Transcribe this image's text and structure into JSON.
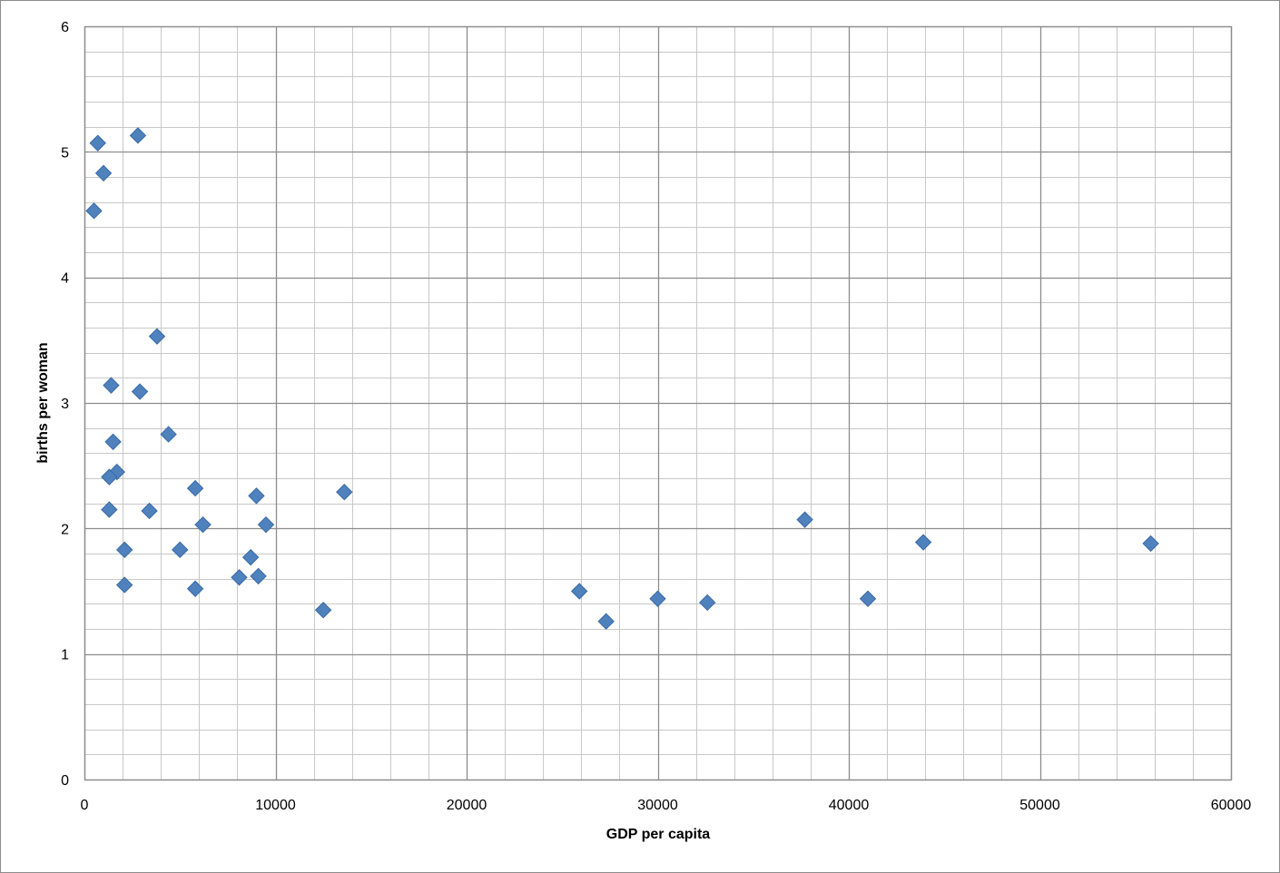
{
  "chart_data": {
    "type": "scatter",
    "title": "",
    "xlabel": "GDP per capita",
    "ylabel": "births per woman",
    "xlim": [
      0,
      60000
    ],
    "ylim": [
      0,
      6
    ],
    "x_major": 10000,
    "x_minor": 2000,
    "y_major": 1,
    "y_minor": 0.2,
    "x_tick_labels": [
      "0",
      "10000",
      "20000",
      "30000",
      "40000",
      "50000",
      "60000"
    ],
    "y_tick_labels": [
      "0",
      "1",
      "2",
      "3",
      "4",
      "5",
      "6"
    ],
    "grid": true,
    "legend": "none",
    "marker": "diamond",
    "colors": {
      "marker": "#4f81bd",
      "marker_edge": "#3a6aa6",
      "major_grid": "#8c8c8c",
      "minor_grid": "#c8c8c8",
      "frame": "#8c8c8c"
    },
    "points": [
      {
        "x": 700,
        "y": 5.07
      },
      {
        "x": 2800,
        "y": 5.13
      },
      {
        "x": 1000,
        "y": 4.83
      },
      {
        "x": 500,
        "y": 4.53
      },
      {
        "x": 3800,
        "y": 3.53
      },
      {
        "x": 1400,
        "y": 3.14
      },
      {
        "x": 2900,
        "y": 3.09
      },
      {
        "x": 4400,
        "y": 2.75
      },
      {
        "x": 1500,
        "y": 2.69
      },
      {
        "x": 1700,
        "y": 2.45
      },
      {
        "x": 1300,
        "y": 2.41
      },
      {
        "x": 5800,
        "y": 2.32
      },
      {
        "x": 9000,
        "y": 2.26
      },
      {
        "x": 13600,
        "y": 2.29
      },
      {
        "x": 1300,
        "y": 2.15
      },
      {
        "x": 3400,
        "y": 2.14
      },
      {
        "x": 6200,
        "y": 2.03
      },
      {
        "x": 9500,
        "y": 2.03
      },
      {
        "x": 2100,
        "y": 1.83
      },
      {
        "x": 5000,
        "y": 1.83
      },
      {
        "x": 8700,
        "y": 1.77
      },
      {
        "x": 8100,
        "y": 1.61
      },
      {
        "x": 9100,
        "y": 1.62
      },
      {
        "x": 2100,
        "y": 1.55
      },
      {
        "x": 5800,
        "y": 1.52
      },
      {
        "x": 12500,
        "y": 1.35
      },
      {
        "x": 25900,
        "y": 1.5
      },
      {
        "x": 27300,
        "y": 1.26
      },
      {
        "x": 30000,
        "y": 1.44
      },
      {
        "x": 32600,
        "y": 1.41
      },
      {
        "x": 37700,
        "y": 2.07
      },
      {
        "x": 41000,
        "y": 1.44
      },
      {
        "x": 43900,
        "y": 1.89
      },
      {
        "x": 55800,
        "y": 1.88
      }
    ]
  }
}
